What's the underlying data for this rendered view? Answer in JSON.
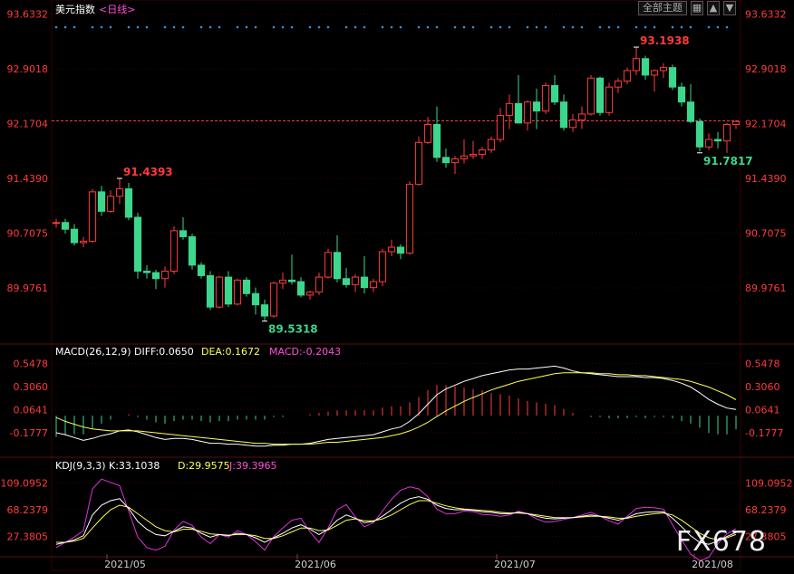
{
  "header": {
    "title": "美元指数",
    "period_label": "<日线>",
    "main_selector": "全部主题",
    "macd_label": "MACD(26,12,9)",
    "macd_diff": "DIFF:0.0650",
    "macd_dea": "DEA:0.1672",
    "macd_macd": "MACD:-0.2043",
    "kdj_label": "KDJ(9,3,3)",
    "kdj_k": "K:33.1038",
    "kdj_d": "D:29.9575",
    "kdj_j": "J:39.3965"
  },
  "watermark": "FX678",
  "colors": {
    "up": "#ff3b3b",
    "down": "#3cd68c",
    "diff": "#ffffff",
    "dea": "#ffff55",
    "j": "#dd33dd",
    "axis_text": "#ff3b3b",
    "grid": "#3a0000"
  },
  "chart_data": [
    {
      "type": "candlestick",
      "title": "美元指数 日线",
      "price_ticks": [
        "93.6332",
        "92.9018",
        "92.1704",
        "91.4390",
        "90.7075",
        "89.9761"
      ],
      "ylim": [
        89.25,
        93.63
      ],
      "x_ticks": [
        "2021/05",
        "2021/06",
        "2021/07",
        "2021/08"
      ],
      "last_price_line": 92.21,
      "annotations": [
        {
          "label": "91.4393",
          "value": 91.4393,
          "type": "high"
        },
        {
          "label": "89.5318",
          "value": 89.5318,
          "type": "low"
        },
        {
          "label": "93.1938",
          "value": 93.1938,
          "type": "high"
        },
        {
          "label": "91.7817",
          "value": 91.7817,
          "type": "low"
        }
      ],
      "ohlc": [
        [
          90.84,
          90.9,
          90.78,
          90.85
        ],
        [
          90.85,
          90.9,
          90.7,
          90.76
        ],
        [
          90.76,
          90.83,
          90.54,
          90.58
        ],
        [
          90.58,
          90.66,
          90.52,
          90.6
        ],
        [
          90.6,
          91.3,
          90.58,
          91.26
        ],
        [
          91.26,
          91.34,
          90.94,
          91.0
        ],
        [
          91.0,
          91.28,
          90.98,
          91.2
        ],
        [
          91.2,
          91.44,
          91.1,
          91.3
        ],
        [
          91.3,
          91.38,
          90.88,
          90.92
        ],
        [
          90.92,
          90.98,
          90.1,
          90.2
        ],
        [
          90.2,
          90.28,
          90.1,
          90.18
        ],
        [
          90.18,
          90.22,
          89.96,
          90.1
        ],
        [
          90.1,
          90.26,
          89.98,
          90.2
        ],
        [
          90.2,
          90.8,
          90.16,
          90.74
        ],
        [
          90.74,
          90.92,
          90.62,
          90.66
        ],
        [
          90.66,
          90.7,
          90.22,
          90.28
        ],
        [
          90.28,
          90.32,
          90.1,
          90.14
        ],
        [
          90.14,
          90.2,
          89.68,
          89.72
        ],
        [
          89.72,
          90.14,
          89.7,
          90.12
        ],
        [
          90.12,
          90.2,
          89.72,
          89.76
        ],
        [
          89.76,
          90.1,
          89.74,
          90.08
        ],
        [
          90.08,
          90.12,
          89.86,
          89.9
        ],
        [
          89.9,
          89.98,
          89.62,
          89.75
        ],
        [
          89.75,
          89.82,
          89.53,
          89.6
        ],
        [
          89.6,
          90.06,
          89.58,
          90.04
        ],
        [
          90.04,
          90.18,
          89.96,
          90.08
        ],
        [
          90.08,
          90.42,
          90.02,
          90.06
        ],
        [
          90.06,
          90.12,
          89.85,
          89.88
        ],
        [
          89.88,
          89.94,
          89.82,
          89.92
        ],
        [
          89.92,
          90.18,
          89.88,
          90.12
        ],
        [
          90.12,
          90.5,
          90.1,
          90.45
        ],
        [
          90.45,
          90.68,
          90.05,
          90.1
        ],
        [
          90.1,
          90.24,
          89.98,
          90.02
        ],
        [
          90.02,
          90.16,
          89.92,
          90.12
        ],
        [
          90.12,
          90.4,
          89.9,
          89.98
        ],
        [
          89.98,
          90.1,
          89.92,
          90.06
        ],
        [
          90.06,
          90.5,
          90.0,
          90.46
        ],
        [
          90.46,
          90.62,
          90.4,
          90.52
        ],
        [
          90.52,
          90.56,
          90.36,
          90.44
        ],
        [
          90.44,
          91.4,
          90.42,
          91.36
        ],
        [
          91.36,
          92.0,
          91.34,
          91.92
        ],
        [
          91.92,
          92.26,
          91.9,
          92.16
        ],
        [
          92.16,
          92.4,
          91.66,
          91.72
        ],
        [
          91.72,
          91.84,
          91.58,
          91.65
        ],
        [
          91.65,
          91.74,
          91.5,
          91.7
        ],
        [
          91.7,
          91.96,
          91.64,
          91.74
        ],
        [
          91.74,
          91.94,
          91.7,
          91.76
        ],
        [
          91.76,
          91.86,
          91.7,
          91.82
        ],
        [
          91.82,
          92.0,
          91.78,
          91.96
        ],
        [
          91.96,
          92.38,
          91.92,
          92.28
        ],
        [
          92.28,
          92.56,
          92.1,
          92.44
        ],
        [
          92.44,
          92.82,
          92.38,
          92.18
        ],
        [
          92.18,
          92.48,
          92.08,
          92.46
        ],
        [
          92.46,
          92.64,
          92.1,
          92.34
        ],
        [
          92.34,
          92.72,
          92.3,
          92.68
        ],
        [
          92.68,
          92.82,
          92.42,
          92.46
        ],
        [
          92.46,
          92.56,
          92.08,
          92.12
        ],
        [
          92.12,
          92.3,
          92.06,
          92.22
        ],
        [
          92.22,
          92.4,
          92.1,
          92.3
        ],
        [
          92.3,
          92.82,
          92.28,
          92.78
        ],
        [
          92.78,
          92.8,
          92.28,
          92.32
        ],
        [
          92.32,
          92.72,
          92.28,
          92.66
        ],
        [
          92.66,
          92.78,
          92.58,
          92.74
        ],
        [
          92.74,
          92.92,
          92.7,
          92.88
        ],
        [
          92.88,
          93.19,
          92.82,
          93.04
        ],
        [
          93.04,
          93.08,
          92.76,
          92.82
        ],
        [
          92.82,
          92.9,
          92.6,
          92.88
        ],
        [
          92.88,
          92.98,
          92.78,
          92.92
        ],
        [
          92.92,
          92.96,
          92.62,
          92.66
        ],
        [
          92.66,
          92.72,
          92.4,
          92.46
        ],
        [
          92.46,
          92.7,
          92.18,
          92.2
        ],
        [
          92.2,
          92.24,
          91.8,
          91.86
        ],
        [
          91.86,
          92.04,
          91.82,
          91.96
        ],
        [
          91.96,
          92.06,
          91.84,
          91.94
        ],
        [
          91.94,
          92.18,
          91.78,
          92.16
        ],
        [
          92.16,
          92.22,
          92.1,
          92.2
        ]
      ],
      "macd_ticks": [
        "0.5478",
        "0.3060",
        "0.0641",
        "-0.1777"
      ],
      "macd_ylim": [
        -0.37,
        0.6
      ],
      "diff": [
        -0.18,
        -0.2,
        -0.23,
        -0.26,
        -0.24,
        -0.21,
        -0.19,
        -0.16,
        -0.15,
        -0.17,
        -0.2,
        -0.23,
        -0.25,
        -0.24,
        -0.24,
        -0.25,
        -0.27,
        -0.29,
        -0.29,
        -0.3,
        -0.3,
        -0.31,
        -0.32,
        -0.32,
        -0.31,
        -0.31,
        -0.3,
        -0.3,
        -0.29,
        -0.27,
        -0.25,
        -0.24,
        -0.23,
        -0.22,
        -0.21,
        -0.2,
        -0.17,
        -0.14,
        -0.12,
        -0.06,
        0.02,
        0.12,
        0.22,
        0.28,
        0.32,
        0.36,
        0.39,
        0.42,
        0.44,
        0.46,
        0.48,
        0.49,
        0.49,
        0.5,
        0.51,
        0.52,
        0.5,
        0.47,
        0.45,
        0.44,
        0.43,
        0.42,
        0.41,
        0.41,
        0.41,
        0.4,
        0.4,
        0.39,
        0.37,
        0.34,
        0.3,
        0.24,
        0.17,
        0.12,
        0.08,
        0.065
      ],
      "dea": [
        -0.02,
        -0.06,
        -0.09,
        -0.12,
        -0.14,
        -0.15,
        -0.16,
        -0.16,
        -0.16,
        -0.16,
        -0.17,
        -0.18,
        -0.19,
        -0.2,
        -0.21,
        -0.22,
        -0.23,
        -0.24,
        -0.25,
        -0.26,
        -0.27,
        -0.28,
        -0.29,
        -0.29,
        -0.3,
        -0.3,
        -0.3,
        -0.3,
        -0.3,
        -0.29,
        -0.28,
        -0.28,
        -0.27,
        -0.26,
        -0.25,
        -0.24,
        -0.23,
        -0.21,
        -0.19,
        -0.16,
        -0.12,
        -0.07,
        -0.01,
        0.05,
        0.1,
        0.15,
        0.19,
        0.23,
        0.27,
        0.3,
        0.33,
        0.36,
        0.38,
        0.4,
        0.42,
        0.44,
        0.45,
        0.45,
        0.45,
        0.45,
        0.44,
        0.44,
        0.43,
        0.43,
        0.42,
        0.42,
        0.41,
        0.4,
        0.39,
        0.38,
        0.36,
        0.33,
        0.3,
        0.26,
        0.22,
        0.1672
      ],
      "kdj_ticks": [
        "109.0952",
        "68.2379",
        "27.3805"
      ],
      "kdj_ylim": [
        0,
        125
      ],
      "k": [
        15,
        18,
        22,
        28,
        60,
        75,
        82,
        85,
        70,
        50,
        38,
        30,
        28,
        35,
        42,
        40,
        32,
        26,
        30,
        28,
        32,
        30,
        25,
        18,
        25,
        32,
        40,
        45,
        38,
        30,
        38,
        52,
        60,
        55,
        48,
        50,
        58,
        68,
        78,
        85,
        88,
        84,
        75,
        70,
        68,
        68,
        67,
        65,
        64,
        62,
        62,
        64,
        62,
        58,
        55,
        54,
        55,
        56,
        58,
        60,
        58,
        55,
        52,
        56,
        62,
        64,
        65,
        65,
        55,
        42,
        28,
        18,
        15,
        20,
        27,
        33
      ],
      "d": [
        18,
        18,
        20,
        24,
        40,
        55,
        68,
        75,
        72,
        62,
        52,
        42,
        36,
        34,
        38,
        38,
        35,
        31,
        30,
        29,
        30,
        30,
        28,
        24,
        24,
        28,
        34,
        40,
        40,
        36,
        37,
        44,
        52,
        54,
        51,
        51,
        54,
        60,
        68,
        76,
        82,
        82,
        78,
        74,
        71,
        69,
        68,
        67,
        66,
        64,
        63,
        63,
        62,
        60,
        58,
        56,
        56,
        56,
        57,
        58,
        58,
        57,
        55,
        55,
        58,
        60,
        62,
        63,
        60,
        52,
        42,
        32,
        25,
        22,
        25,
        30
      ],
      "j": [
        10,
        18,
        26,
        36,
        100,
        115,
        110,
        105,
        66,
        26,
        10,
        6,
        12,
        37,
        50,
        44,
        26,
        16,
        30,
        26,
        36,
        30,
        19,
        6,
        27,
        40,
        52,
        55,
        34,
        18,
        40,
        68,
        76,
        57,
        42,
        48,
        66,
        84,
        98,
        103,
        100,
        88,
        69,
        62,
        62,
        66,
        65,
        61,
        60,
        58,
        60,
        66,
        62,
        54,
        49,
        50,
        53,
        56,
        60,
        64,
        58,
        51,
        46,
        58,
        70,
        72,
        71,
        69,
        45,
        22,
        0,
        -10,
        -5,
        16,
        31,
        39
      ]
    }
  ]
}
